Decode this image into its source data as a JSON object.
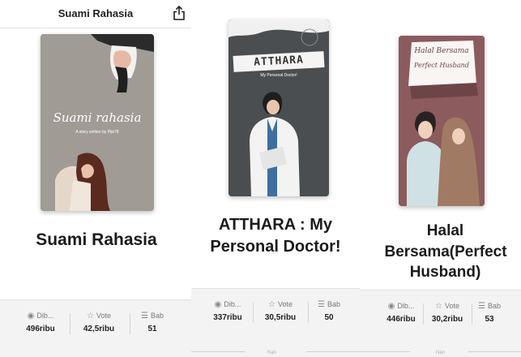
{
  "header": {
    "title": "Suami Rahasia"
  },
  "books": [
    {
      "cover_title": "Suami rahasia",
      "cover_subtitle": "A story written by Plpi78",
      "title": "Suami Rahasia",
      "stats": {
        "dibaca_label": "Dib...",
        "dibaca": "496ribu",
        "vote_label": "Vote",
        "vote": "42,5ribu",
        "bab_label": "Bab",
        "bab": "51"
      }
    },
    {
      "cover_title": "ATTHARA",
      "cover_subtitle": "My Personal Doctor!",
      "title": "ATTHARA : My Personal Doctor!",
      "stats": {
        "dibaca_label": "Dib...",
        "dibaca": "337ribu",
        "vote_label": "Vote",
        "vote": "30,5ribu",
        "bab_label": "Bab",
        "bab": "50"
      },
      "hint": "Nan"
    },
    {
      "cover_title": "Halal Bersama",
      "cover_subtitle": "Perfect Husband",
      "title": "Halal Bersama(Perfect Husband)",
      "stats": {
        "dibaca_label": "Dib...",
        "dibaca": "446ribu",
        "vote_label": "Vote",
        "vote": "30,2ribu",
        "bab_label": "Bab",
        "bab": "53"
      },
      "hint": "Nan"
    }
  ],
  "icons": {
    "share": "share-icon",
    "eye": "eye-icon",
    "star": "star-icon",
    "list": "list-icon"
  }
}
